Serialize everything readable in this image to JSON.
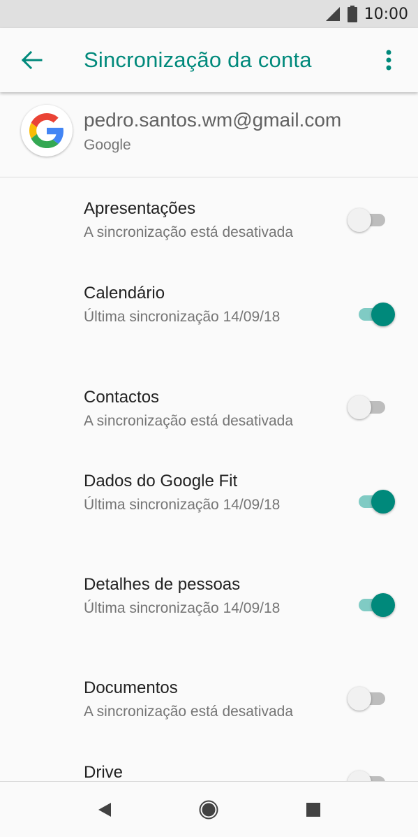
{
  "status": {
    "time": "10:00"
  },
  "toolbar": {
    "title": "Sincronização da conta"
  },
  "account": {
    "email": "pedro.santos.wm@gmail.com",
    "type": "Google"
  },
  "colors": {
    "accent": "#00897b",
    "accent_light": "#80cbc4",
    "off_track": "#bdbdbd"
  },
  "sync_items": [
    {
      "title": "Apresentações",
      "subtitle": "A sincronização está desativada",
      "enabled": false
    },
    {
      "title": "Calendário",
      "subtitle": "Última sincronização 14/09/18",
      "enabled": true
    },
    {
      "title": "Contactos",
      "subtitle": "A sincronização está desativada",
      "enabled": false
    },
    {
      "title": "Dados do Google Fit",
      "subtitle": "Última sincronização 14/09/18",
      "enabled": true
    },
    {
      "title": "Detalhes de pessoas",
      "subtitle": "Última sincronização 14/09/18",
      "enabled": true
    },
    {
      "title": "Documentos",
      "subtitle": "A sincronização está desativada",
      "enabled": false
    },
    {
      "title": "Drive",
      "subtitle": "",
      "enabled": false
    }
  ],
  "icons": {
    "back": "arrow-back-icon",
    "more": "more-vert-icon",
    "signal": "signal-icon",
    "battery": "battery-icon",
    "google": "google-logo-icon",
    "nav_back": "nav-back-icon",
    "nav_home": "nav-home-icon",
    "nav_recents": "nav-recents-icon"
  }
}
